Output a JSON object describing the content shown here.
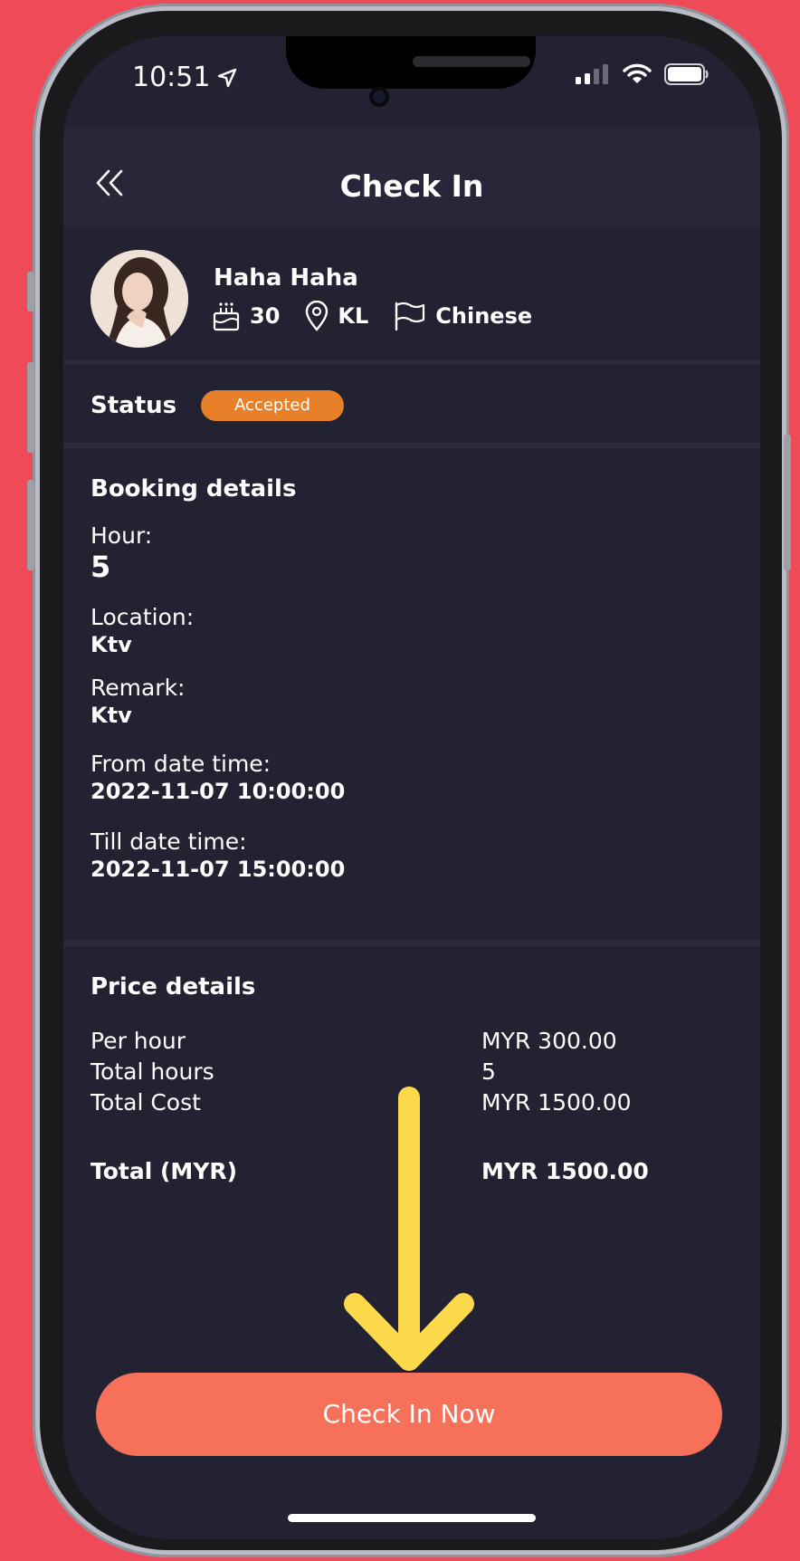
{
  "status_bar": {
    "time": "10:51"
  },
  "header": {
    "title": "Check In"
  },
  "profile": {
    "name": "Haha Haha",
    "age": "30",
    "location": "KL",
    "language": "Chinese"
  },
  "status": {
    "label": "Status",
    "value": "Accepted",
    "badge_color": "#e8802a"
  },
  "booking": {
    "title": "Booking details",
    "hour_label": "Hour:",
    "hour_value": "5",
    "location_label": "Location:",
    "location_value": "Ktv",
    "remark_label": "Remark:",
    "remark_value": "Ktv",
    "from_label": "From date time:",
    "from_value": "2022-11-07 10:00:00",
    "till_label": "Till date time:",
    "till_value": "2022-11-07 15:00:00"
  },
  "price": {
    "title": "Price details",
    "rows": [
      {
        "label": "Per hour",
        "value": "MYR 300.00"
      },
      {
        "label": "Total hours",
        "value": "5"
      },
      {
        "label": "Total Cost",
        "value": "MYR 1500.00"
      }
    ],
    "total_label": "Total (MYR)",
    "total_value": "MYR 1500.00"
  },
  "actions": {
    "check_in_label": "Check In Now",
    "button_color": "#f7715a"
  },
  "colors": {
    "background": "#ef4a57",
    "screen": "#232233",
    "arrow": "#fcd94b"
  }
}
